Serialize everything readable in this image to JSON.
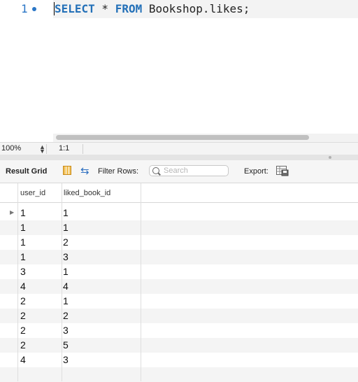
{
  "editor": {
    "line_number": "1",
    "code": {
      "kw1": "SELECT",
      "star": " * ",
      "kw2": "FROM",
      "rest": " Bookshop.likes;"
    }
  },
  "statusbar": {
    "zoom": "100%",
    "position": "1:1"
  },
  "toolbar": {
    "title": "Result Grid",
    "filter_label": "Filter Rows:",
    "search_placeholder": "Search",
    "export_label": "Export:"
  },
  "grid": {
    "columns": [
      "user_id",
      "liked_book_id"
    ],
    "rows": [
      [
        "1",
        "1"
      ],
      [
        "1",
        "1"
      ],
      [
        "1",
        "2"
      ],
      [
        "1",
        "3"
      ],
      [
        "3",
        "1"
      ],
      [
        "4",
        "4"
      ],
      [
        "2",
        "1"
      ],
      [
        "2",
        "2"
      ],
      [
        "2",
        "3"
      ],
      [
        "2",
        "5"
      ],
      [
        "4",
        "3"
      ]
    ],
    "current_row_marker": "▶"
  },
  "colors": {
    "keyword": "#2370b8",
    "line_number": "#2a76c6",
    "alt_row": "#f4f4f4"
  }
}
